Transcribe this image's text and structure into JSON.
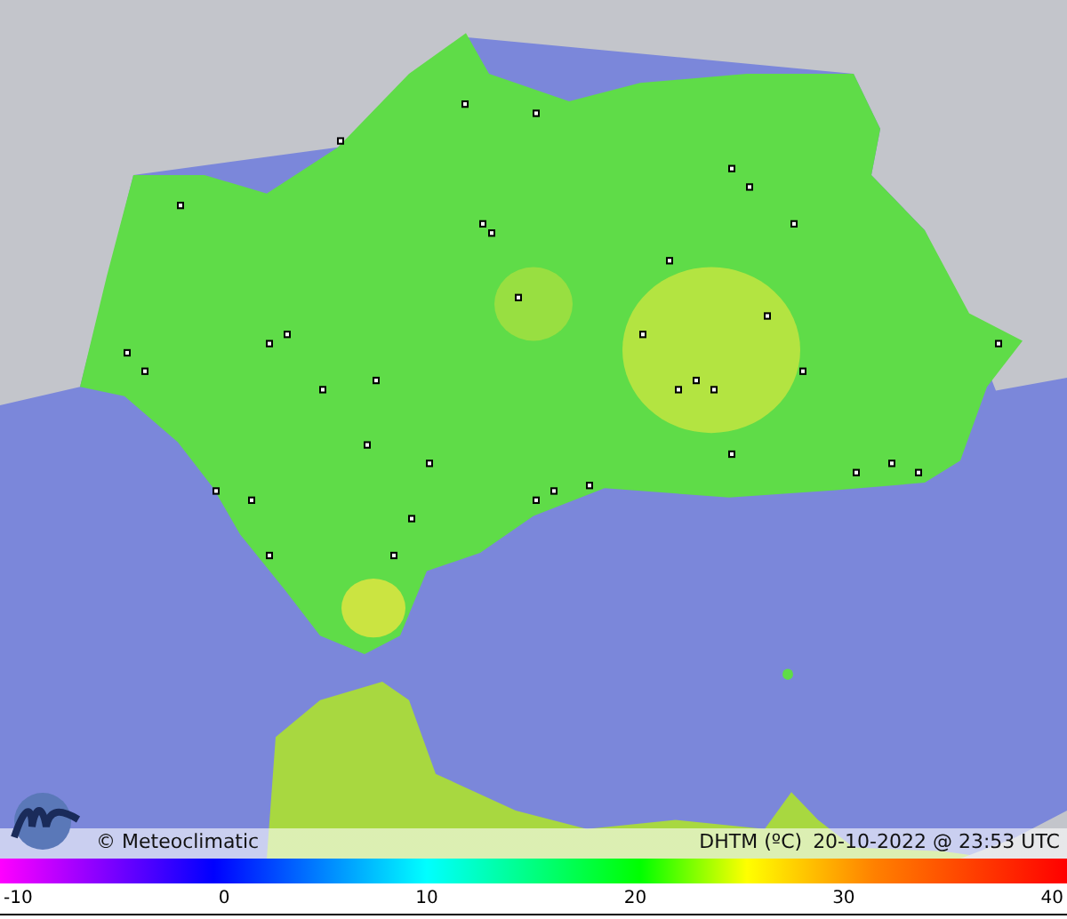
{
  "caption": {
    "credit": "© Meteoclimatic",
    "variable": "DHTM (ºC)",
    "timestamp": "20-10-2022 @ 23:53 UTC"
  },
  "scale": {
    "labels": [
      "-10",
      "0",
      "10",
      "20",
      "30",
      "40"
    ]
  }
}
